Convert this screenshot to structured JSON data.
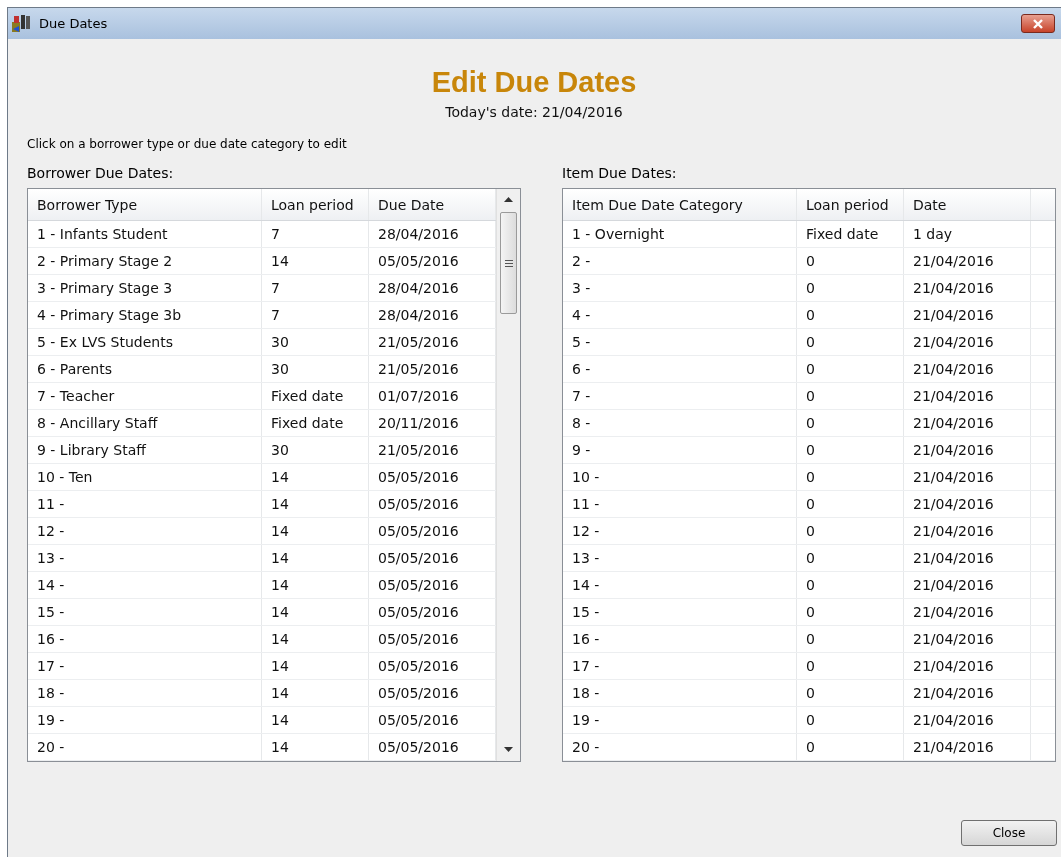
{
  "window": {
    "title": "Due Dates"
  },
  "heading": "Edit Due Dates",
  "today": "Today's date: 21/04/2016",
  "instruction": "Click on a borrower type or due date category to edit",
  "borrower_table": {
    "label": "Borrower Due Dates:",
    "columns": [
      "Borrower Type",
      "Loan period",
      "Due Date"
    ],
    "rows": [
      [
        "1 - Infants Student",
        "7",
        "28/04/2016"
      ],
      [
        "2 - Primary Stage 2",
        "14",
        "05/05/2016"
      ],
      [
        "3 - Primary Stage 3",
        "7",
        "28/04/2016"
      ],
      [
        "4 - Primary Stage 3b",
        "7",
        "28/04/2016"
      ],
      [
        "5 - Ex LVS Students",
        "30",
        "21/05/2016"
      ],
      [
        "6 - Parents",
        "30",
        "21/05/2016"
      ],
      [
        "7 - Teacher",
        "Fixed date",
        "01/07/2016"
      ],
      [
        "8 - Ancillary Staff",
        "Fixed date",
        "20/11/2016"
      ],
      [
        "9 - Library Staff",
        "30",
        "21/05/2016"
      ],
      [
        "10 - Ten",
        "14",
        "05/05/2016"
      ],
      [
        "11 -",
        "14",
        "05/05/2016"
      ],
      [
        "12 -",
        "14",
        "05/05/2016"
      ],
      [
        "13 -",
        "14",
        "05/05/2016"
      ],
      [
        "14 -",
        "14",
        "05/05/2016"
      ],
      [
        "15 -",
        "14",
        "05/05/2016"
      ],
      [
        "16 -",
        "14",
        "05/05/2016"
      ],
      [
        "17 -",
        "14",
        "05/05/2016"
      ],
      [
        "18 -",
        "14",
        "05/05/2016"
      ],
      [
        "19 -",
        "14",
        "05/05/2016"
      ],
      [
        "20 -",
        "14",
        "05/05/2016"
      ]
    ]
  },
  "item_table": {
    "label": "Item Due Dates:",
    "columns": [
      "Item Due Date Category",
      "Loan period",
      "Date"
    ],
    "rows": [
      [
        "1 - Overnight",
        "Fixed date",
        "1 day"
      ],
      [
        "2 -",
        "0",
        "21/04/2016"
      ],
      [
        "3 -",
        "0",
        "21/04/2016"
      ],
      [
        "4 -",
        "0",
        "21/04/2016"
      ],
      [
        "5 -",
        "0",
        "21/04/2016"
      ],
      [
        "6 -",
        "0",
        "21/04/2016"
      ],
      [
        "7 -",
        "0",
        "21/04/2016"
      ],
      [
        "8 -",
        "0",
        "21/04/2016"
      ],
      [
        "9 -",
        "0",
        "21/04/2016"
      ],
      [
        "10 -",
        "0",
        "21/04/2016"
      ],
      [
        "11 -",
        "0",
        "21/04/2016"
      ],
      [
        "12 -",
        "0",
        "21/04/2016"
      ],
      [
        "13 -",
        "0",
        "21/04/2016"
      ],
      [
        "14 -",
        "0",
        "21/04/2016"
      ],
      [
        "15 -",
        "0",
        "21/04/2016"
      ],
      [
        "16 -",
        "0",
        "21/04/2016"
      ],
      [
        "17 -",
        "0",
        "21/04/2016"
      ],
      [
        "18 -",
        "0",
        "21/04/2016"
      ],
      [
        "19 -",
        "0",
        "21/04/2016"
      ],
      [
        "20 -",
        "0",
        "21/04/2016"
      ]
    ]
  },
  "buttons": [
    "Close"
  ]
}
